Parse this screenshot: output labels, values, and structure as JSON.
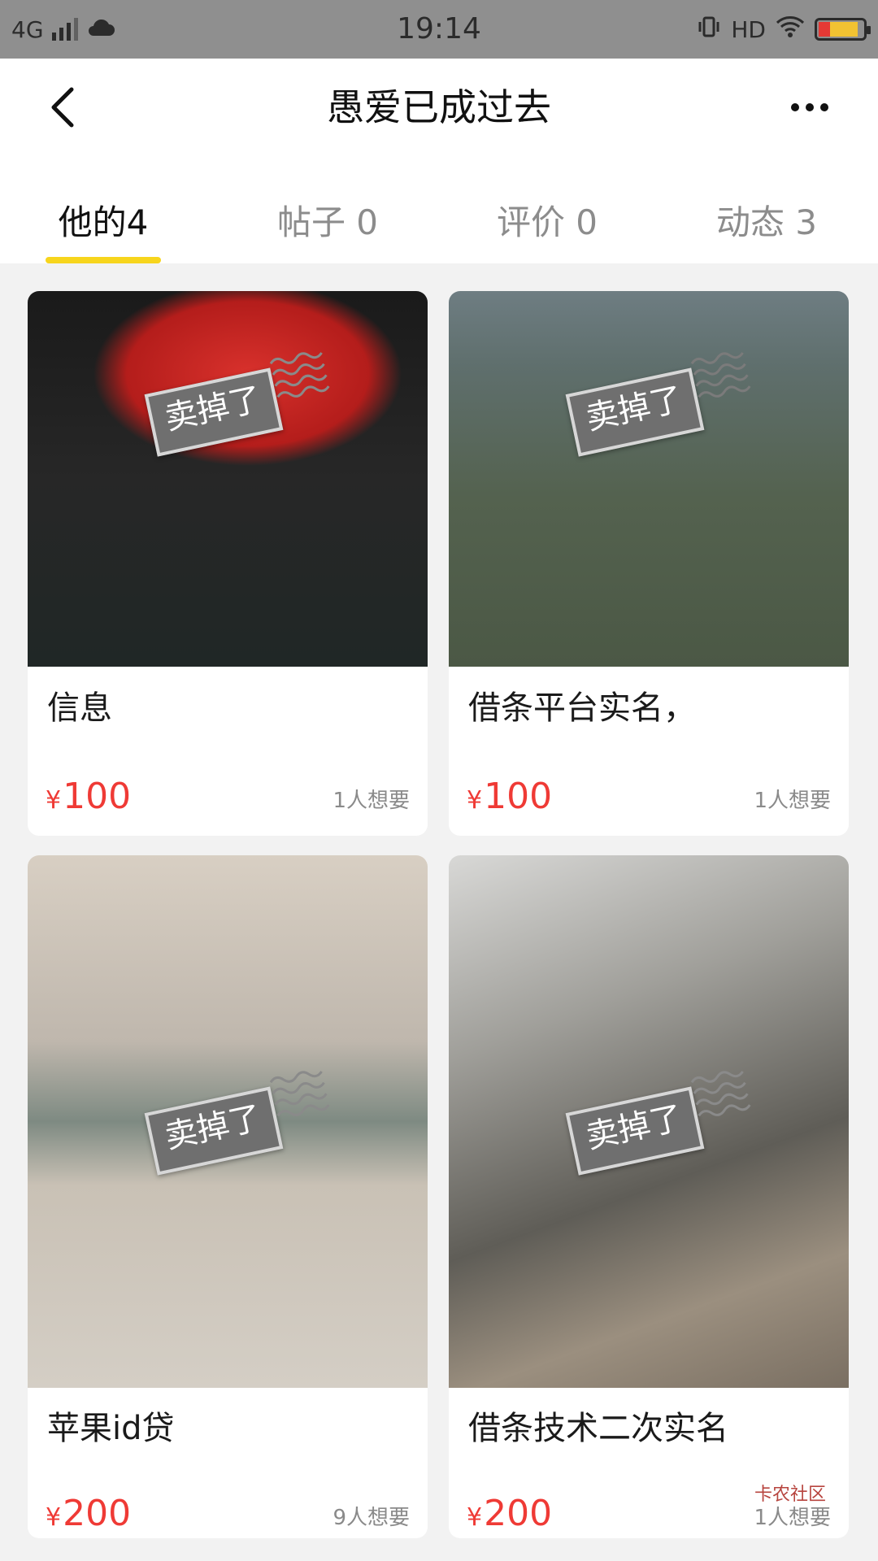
{
  "status_bar": {
    "network": "4G",
    "time": "19:14",
    "hd": "HD"
  },
  "header": {
    "title": "愚爱已成过去"
  },
  "tabs": [
    {
      "label": "他的4",
      "active": true
    },
    {
      "label": "帖子 0",
      "active": false
    },
    {
      "label": "评价 0",
      "active": false
    },
    {
      "label": "动态 3",
      "active": false
    }
  ],
  "items": [
    {
      "title": "信息",
      "price": "100",
      "wants": "1人想要",
      "sold_label": "卖掉了"
    },
    {
      "title": "借条平台实名，",
      "price": "100",
      "wants": "1人想要",
      "sold_label": "卖掉了"
    },
    {
      "title": "苹果id贷",
      "price": "200",
      "wants": "9人想要",
      "sold_label": "卖掉了"
    },
    {
      "title": "借条技术二次实名",
      "price": "200",
      "wants": "1人想要",
      "sold_label": "卖掉了"
    }
  ],
  "currency_symbol": "¥",
  "watermark": "卡农社区",
  "colors": {
    "accent_yellow": "#f7d51d",
    "price_red": "#ef3a35"
  }
}
